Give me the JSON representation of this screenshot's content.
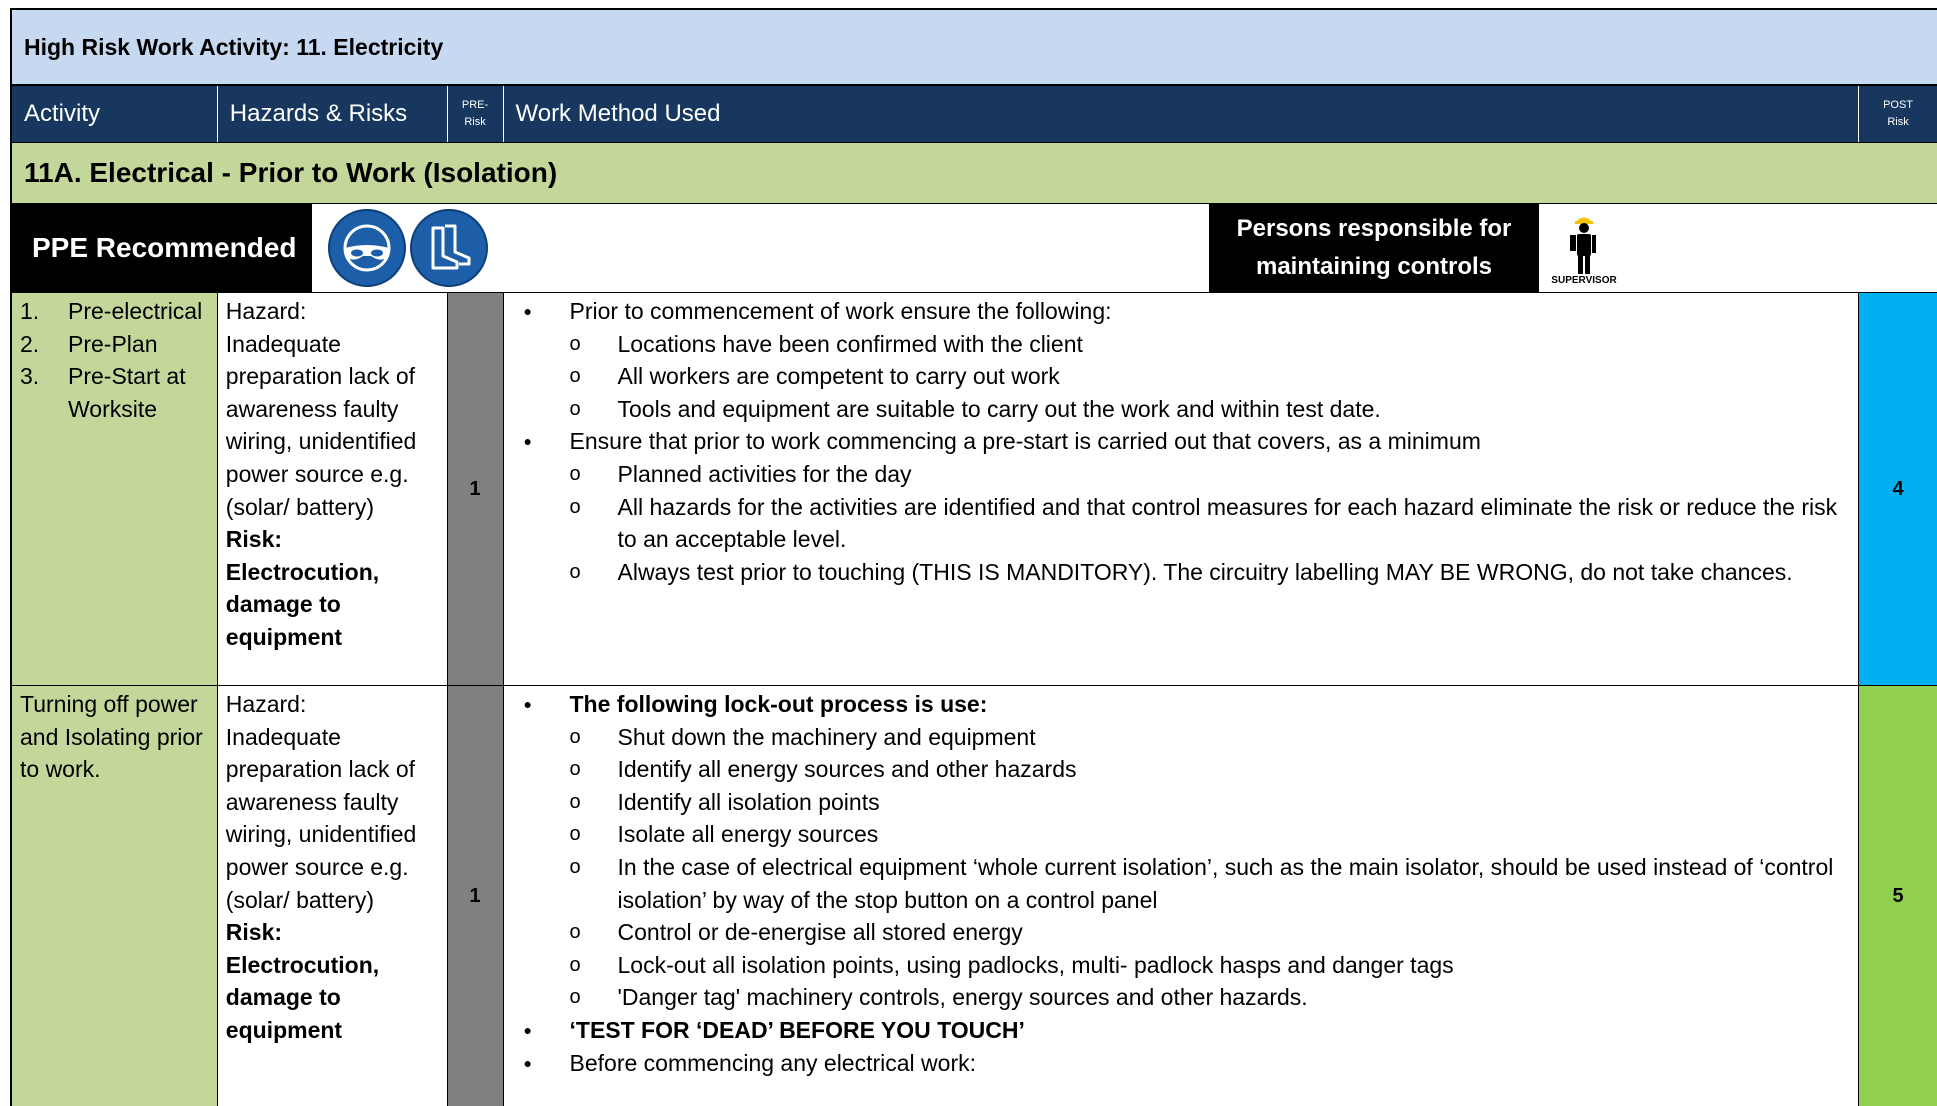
{
  "title": "High Risk Work Activity: 11. Electricity",
  "header": {
    "activity": "Activity",
    "hazards": "Hazards & Risks",
    "pre_line1": "PRE-",
    "pre_line2": "Risk",
    "method": "Work Method Used",
    "post_line1": "POST",
    "post_line2": "Risk"
  },
  "section": "11A. Electrical - Prior to Work (Isolation)",
  "ppe": {
    "label": "PPE Recommended",
    "icons": [
      "safety-glasses-icon",
      "safety-boots-icon"
    ],
    "responsible_line1": "Persons responsible for",
    "responsible_line2": "maintaining controls",
    "supervisor_label": "SUPERVISOR"
  },
  "rows": [
    {
      "activity_items": [
        {
          "num": "1.",
          "text": "Pre-electrical"
        },
        {
          "num": "2.",
          "text": "Pre-Plan"
        },
        {
          "num": "3.",
          "text": "Pre-Start at Worksite"
        }
      ],
      "hazard_label": "Hazard:",
      "hazard_text": "Inadequate preparation lack of awareness faulty wiring, unidentified power source e.g. (solar/ battery)",
      "risk_label": "Risk:",
      "risk_text": "Electrocution, damage to equipment",
      "pre": "1",
      "post": "4",
      "method": [
        {
          "level": 1,
          "text": "Prior to commencement of work ensure the following:"
        },
        {
          "level": 2,
          "text": "Locations have been confirmed with the client"
        },
        {
          "level": 2,
          "text": "All workers are competent to carry out work"
        },
        {
          "level": 2,
          "text": "Tools and equipment are suitable to carry out the work and within test date."
        },
        {
          "level": 1,
          "text": "Ensure that prior to work commencing a pre-start is carried out that covers, as a minimum"
        },
        {
          "level": 2,
          "text": "Planned activities for the day"
        },
        {
          "level": 2,
          "text": "All hazards for the activities are identified and that control measures for each hazard eliminate the risk or reduce the risk to an acceptable level."
        },
        {
          "level": 2,
          "text": "Always test prior to touching (THIS IS MANDITORY). The circuitry labelling MAY BE WRONG, do not take chances."
        }
      ]
    },
    {
      "activity_text": "Turning off power and Isolating prior to work.",
      "hazard_label": "Hazard:",
      "hazard_text": "Inadequate preparation lack of awareness faulty wiring, unidentified power source e.g. (solar/ battery)",
      "risk_label": "Risk:",
      "risk_text": "Electrocution, damage to equipment",
      "pre": "1",
      "post": "5",
      "method": [
        {
          "level": 1,
          "bold": true,
          "text": "The following lock-out process is use:"
        },
        {
          "level": 2,
          "text": "Shut down the machinery and equipment"
        },
        {
          "level": 2,
          "text": "Identify all energy sources and other hazards"
        },
        {
          "level": 2,
          "text": "Identify all isolation points"
        },
        {
          "level": 2,
          "text": "Isolate all energy sources"
        },
        {
          "level": 2,
          "text": "In the case of electrical equipment ‘whole current isolation’, such as the main isolator, should be used instead of ‘control isolation’ by way of the stop button on a control panel"
        },
        {
          "level": 2,
          "text": "Control or de-energise all stored energy"
        },
        {
          "level": 2,
          "text": "Lock-out all isolation points, using padlocks, multi- padlock hasps and danger tags"
        },
        {
          "level": 2,
          "text": "'Danger tag' machinery controls, energy sources and other hazards."
        },
        {
          "level": 1,
          "bold": true,
          "text": "‘TEST FOR ‘DEAD’ BEFORE YOU TOUCH’"
        },
        {
          "level": 1,
          "text": "Before commencing any electrical work:"
        }
      ]
    }
  ]
}
